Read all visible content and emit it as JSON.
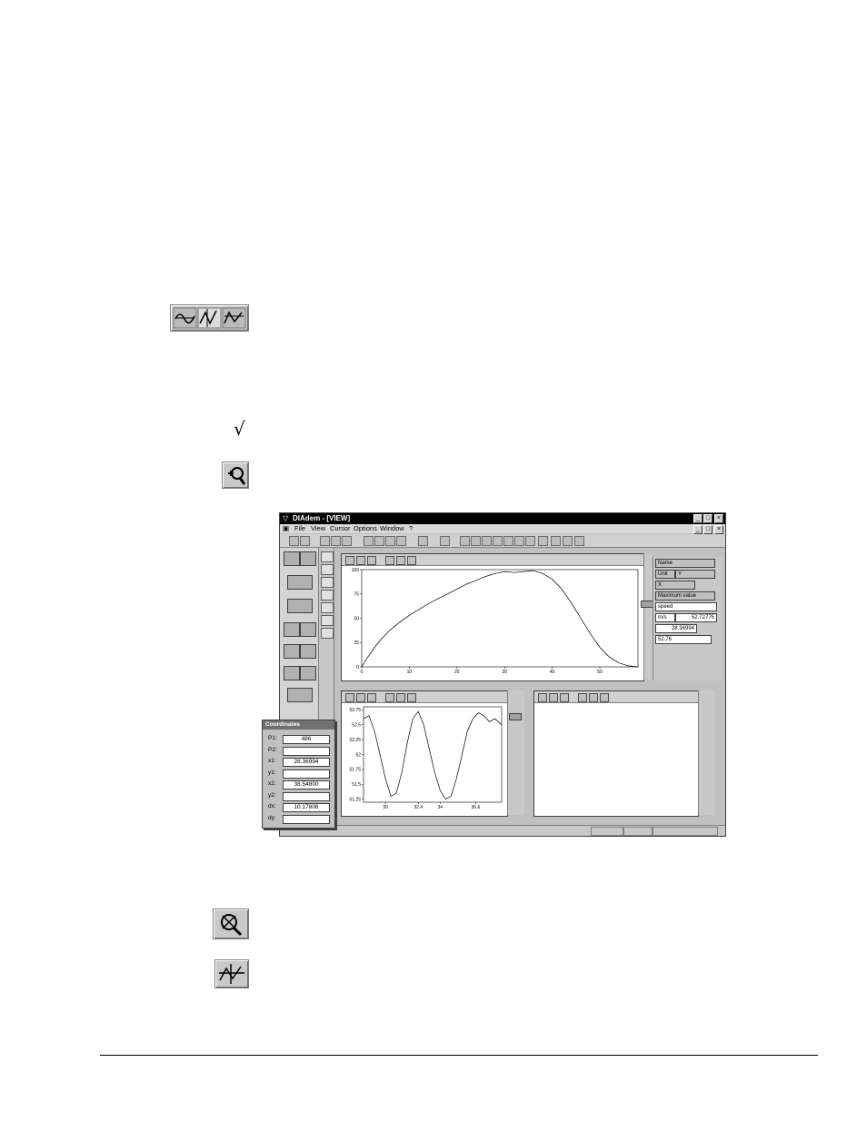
{
  "window": {
    "title": "DIAdem - [VIEW]",
    "menu": [
      "File",
      "View",
      "Cursor",
      "Options",
      "Window",
      "?"
    ],
    "controls": {
      "minimize": "_",
      "maximize": "□",
      "close": "×"
    }
  },
  "checkmark": "√",
  "info_panel": {
    "header": "Name",
    "unit_label": "Unit",
    "unit_value": "Y",
    "x_label": "X",
    "max_label": "Maximum value",
    "channel_name": "speed",
    "unit": "m/s",
    "max_value": "52.72775",
    "x_value": "28.36994",
    "y_value": "52.76"
  },
  "coordinates": {
    "title": "Coordinates",
    "rows": [
      {
        "label": "P1:",
        "value": "486"
      },
      {
        "label": "P2:",
        "value": ""
      },
      {
        "label": "x1:",
        "value": "28.36994"
      },
      {
        "label": "y1:",
        "value": ""
      },
      {
        "label": "x2:",
        "value": "38.54800"
      },
      {
        "label": "y2:",
        "value": ""
      },
      {
        "label": "dx:",
        "value": "10.17806"
      },
      {
        "label": "dy:",
        "value": ""
      }
    ]
  },
  "chart_data": [
    {
      "type": "line",
      "title": "",
      "x_ticks": [
        "0",
        "10",
        "20",
        "30",
        "40",
        "50"
      ],
      "y_ticks": [
        "0",
        "25",
        "50",
        "75",
        "100"
      ],
      "xlim": [
        0,
        58
      ],
      "ylim": [
        0,
        100
      ],
      "series": [
        {
          "x": [
            0,
            1,
            2,
            3,
            4,
            6,
            8,
            10,
            12,
            14,
            16,
            18,
            20,
            22,
            24,
            26,
            28,
            30,
            32,
            34,
            36,
            38,
            40,
            42,
            44,
            46,
            48,
            50,
            52,
            54,
            56,
            58
          ],
          "values": [
            0,
            8,
            15,
            22,
            28,
            38,
            46,
            53,
            59,
            65,
            70,
            75,
            80,
            85,
            89,
            93,
            96,
            98,
            97,
            98,
            99,
            96,
            90,
            80,
            66,
            50,
            34,
            20,
            10,
            4,
            1,
            0
          ]
        }
      ]
    },
    {
      "type": "line",
      "title": "",
      "x_ticks": [
        "30",
        "32.4",
        "34",
        "36.6"
      ],
      "y_ticks": [
        "52.75",
        "52.5",
        "52.25",
        "52",
        "51.75",
        "51.5",
        "51.25"
      ],
      "xlim": [
        28.4,
        38.5
      ],
      "ylim": [
        51.2,
        52.8
      ],
      "series": [
        {
          "x": [
            28.4,
            28.8,
            29.2,
            29.6,
            30.0,
            30.4,
            30.8,
            31.2,
            31.6,
            32.0,
            32.4,
            32.8,
            33.2,
            33.6,
            34.0,
            34.4,
            34.8,
            35.2,
            35.6,
            36.0,
            36.4,
            36.8,
            37.2,
            37.6,
            38.0,
            38.5
          ],
          "values": [
            52.6,
            52.65,
            52.4,
            52.0,
            51.6,
            51.3,
            51.35,
            51.7,
            52.2,
            52.6,
            52.72,
            52.5,
            52.1,
            51.7,
            51.4,
            51.25,
            51.3,
            51.6,
            52.0,
            52.4,
            52.6,
            52.7,
            52.65,
            52.55,
            52.6,
            52.5
          ]
        }
      ]
    }
  ]
}
